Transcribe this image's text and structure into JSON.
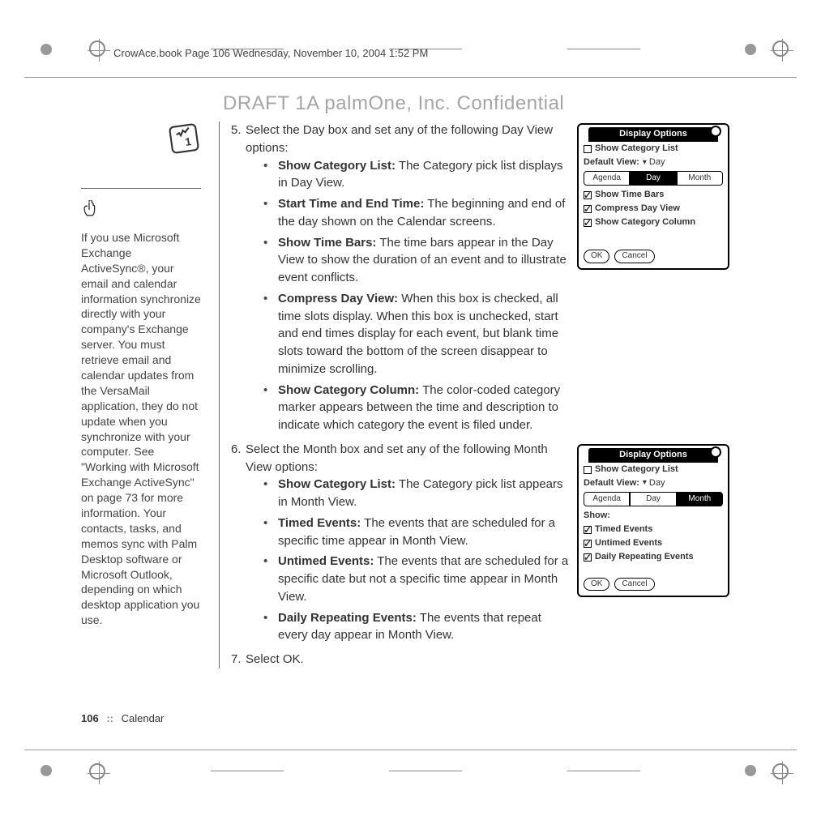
{
  "header": {
    "running_head": "CrowAce.book  Page 106  Wednesday, November 10, 2004  1:52 PM"
  },
  "watermark": "DRAFT 1A  palmOne, Inc.   Confidential",
  "sidebar": {
    "tip": "If you use Microsoft Exchange ActiveSync®, your email and calendar information synchronize directly with your company's Exchange server. You must retrieve email and calendar updates from the VersaMail application, they do not update when you synchronize with your computer. See \"Working with Microsoft Exchange ActiveSync\" on page 73 for more information. Your contacts, tasks, and memos sync with Palm Desktop software or Microsoft Outlook, depending on which desktop application you use."
  },
  "steps": {
    "s5": {
      "num": "5.",
      "intro": "Select the Day box and set any of the following Day View options:",
      "items": [
        {
          "label": "Show Category List:",
          "desc": " The Category pick list displays in Day View."
        },
        {
          "label": "Start Time and End Time:",
          "desc": " The beginning and end of the day shown on the Calendar screens."
        },
        {
          "label": "Show Time Bars:",
          "desc": " The time bars appear in the Day View to show the duration of an event and to illustrate event conflicts."
        },
        {
          "label": "Compress Day View:",
          "desc": " When this box is checked, all time slots display. When this box is unchecked, start and end times display for each event, but blank time slots toward the bottom of the screen disappear to minimize scrolling."
        },
        {
          "label": "Show Category Column:",
          "desc": " The color-coded category marker appears between the time and description to indicate which category the event is filed under."
        }
      ]
    },
    "s6": {
      "num": "6.",
      "intro": "Select the Month box and set any of the following Month View options:",
      "items": [
        {
          "label": "Show Category List:",
          "desc": " The Category pick list appears in Month View."
        },
        {
          "label": "Timed Events:",
          "desc": " The events that are scheduled for a specific time appear in Month View."
        },
        {
          "label": "Untimed Events:",
          "desc": " The events that are scheduled for a specific date but not a specific time appear in Month View."
        },
        {
          "label": "Daily Repeating Events:",
          "desc": " The events that repeat every day appear in Month View."
        }
      ]
    },
    "s7": {
      "num": "7.",
      "intro": "Select OK."
    }
  },
  "palm1": {
    "title": "Display Options",
    "row1": "Show Category List",
    "default_label": "Default View:",
    "default_value": "Day",
    "tabs": [
      "Agenda",
      "Day",
      "Month"
    ],
    "selected_tab_index": 1,
    "opts": [
      "Show Time Bars",
      "Compress Day View",
      "Show Category Column"
    ],
    "ok": "OK",
    "cancel": "Cancel"
  },
  "palm2": {
    "title": "Display Options",
    "row1": "Show Category List",
    "default_label": "Default View:",
    "default_value": "Day",
    "tabs": [
      "Agenda",
      "Day",
      "Month"
    ],
    "selected_tab_index": 2,
    "show_label": "Show:",
    "opts": [
      "Timed Events",
      "Untimed Events",
      "Daily Repeating Events"
    ],
    "ok": "OK",
    "cancel": "Cancel"
  },
  "footer": {
    "page": "106",
    "sep": "::",
    "section": "Calendar"
  }
}
